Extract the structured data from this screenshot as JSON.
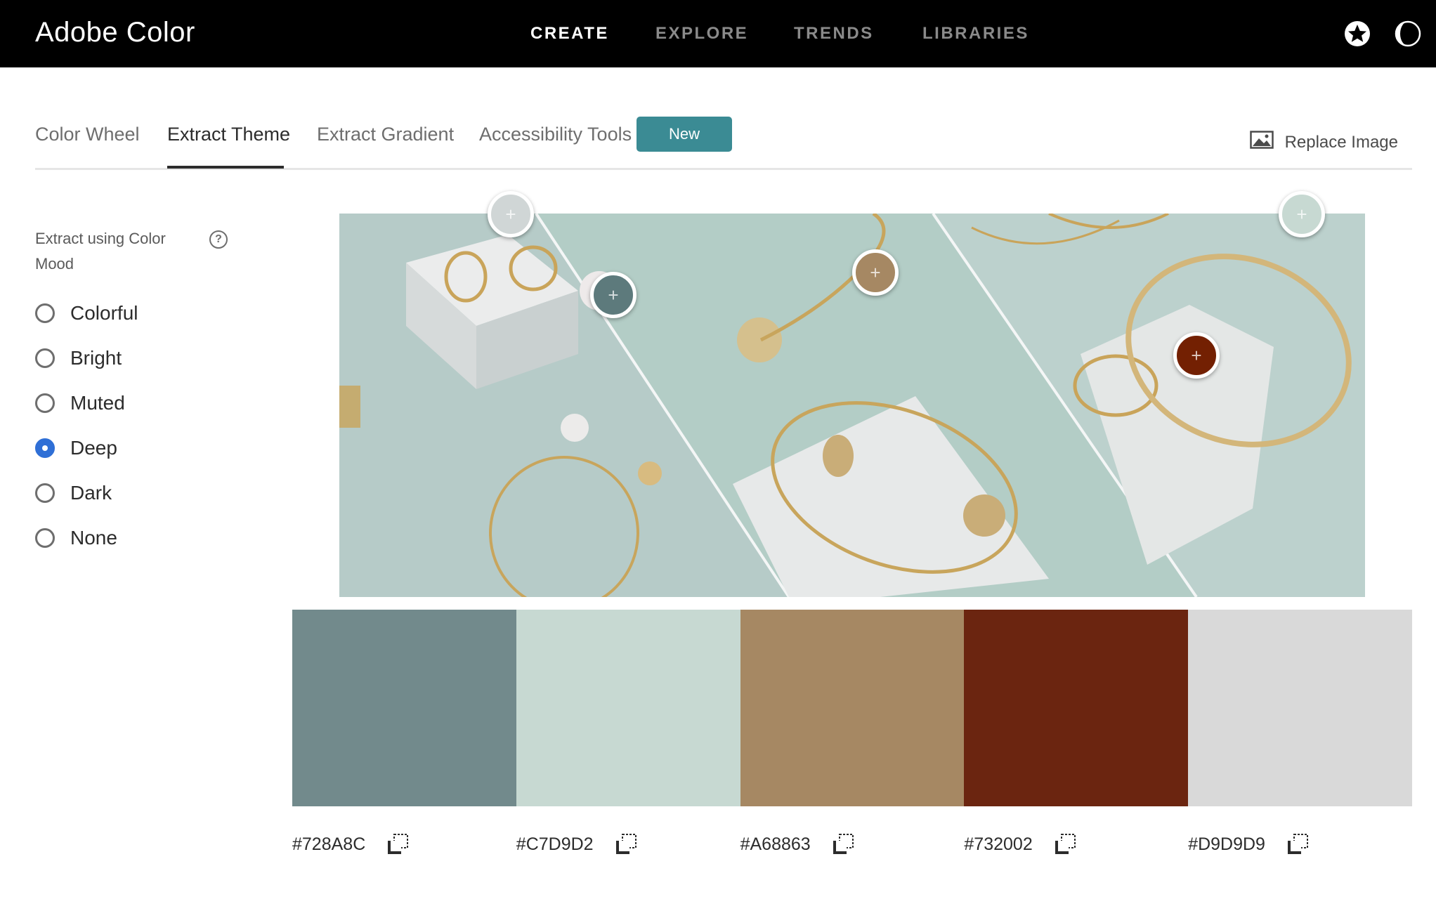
{
  "app": {
    "brand": "Adobe Color"
  },
  "nav": {
    "items": [
      "CREATE",
      "EXPLORE",
      "TRENDS",
      "LIBRARIES"
    ],
    "active": "CREATE"
  },
  "header_icons": [
    "star-icon",
    "theme-toggle-icon"
  ],
  "tabs": {
    "items": [
      "Color Wheel",
      "Extract Theme",
      "Extract Gradient",
      "Accessibility Tools"
    ],
    "active": "Extract Theme",
    "badge": "New",
    "replace_label": "Replace Image"
  },
  "panel": {
    "title": "Extract using Color Mood",
    "help": "?",
    "moods": [
      "Colorful",
      "Bright",
      "Muted",
      "Deep",
      "Dark",
      "None"
    ],
    "selected": "Deep"
  },
  "pickers": [
    {
      "color": "#d0d6d6"
    },
    {
      "color": "#5d7a7c"
    },
    {
      "color": "#a68863"
    },
    {
      "color": "#732002"
    },
    {
      "color": "#c7d9d2"
    }
  ],
  "swatches": [
    {
      "hex": "#728A8C",
      "color": "#728A8C"
    },
    {
      "hex": "#C7D9D2",
      "color": "#C7D9D2"
    },
    {
      "hex": "#A68863",
      "color": "#A68863"
    },
    {
      "hex": "#732002",
      "color": "#6b2510"
    },
    {
      "hex": "#D9D9D9",
      "color": "#D9D9D9"
    }
  ],
  "colors": {
    "accent": "#3b8b94",
    "radio_checked": "#2f6fd6",
    "topbar": "#000000"
  }
}
